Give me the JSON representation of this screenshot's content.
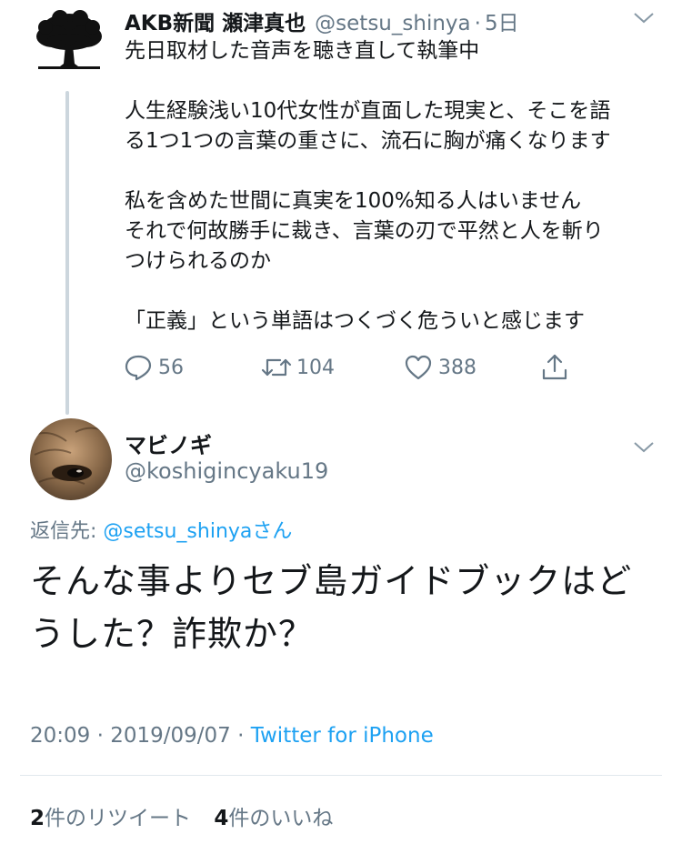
{
  "parent_tweet": {
    "display_name": "AKB新聞 瀬津真也",
    "handle": "@setsu_shinya",
    "separator": "·",
    "time": "5日",
    "paragraphs": [
      "先日取材した音声を聴き直して執筆中",
      "人生経験浅い10代女性が直面した現実と、そこを語\nる1つ1つの言葉の重さに、流石に胸が痛くなります",
      "私を含めた世間に真実を100%知る人はいません\nそれで何故勝手に裁き、言葉の刃で平然と人を斬り\nつけられるのか",
      "「正義」という単語はつくづく危ういと感じます"
    ],
    "reply_count": "56",
    "retweet_count": "104",
    "like_count": "388"
  },
  "reply_tweet": {
    "display_name": "マビノギ",
    "handle": "@koshigincyaku19",
    "replying_label": "返信先: ",
    "replying_mention": "@setsu_shinya",
    "replying_suffix": "さん",
    "text": "そんな事よりセブ島ガイドブックはどうした？詐欺か？",
    "time": "20:09",
    "meta_separator": " · ",
    "date": "2019/09/07",
    "source": "Twitter for iPhone",
    "retweets_count": "2",
    "retweets_label": "件のリツイート",
    "likes_count": "4",
    "likes_label": "件のいいね"
  },
  "colors": {
    "text": "#14171a",
    "secondary": "#657786",
    "link": "#1da1f2",
    "thread_line": "#ccd6dd",
    "divider": "#e1e8ed"
  },
  "icons": {
    "parent_avatar": "tree-logo",
    "reply_avatar": "dog-face-photo",
    "reply": "speech-bubble-icon",
    "retweet": "retweet-arrows-icon",
    "like": "heart-icon",
    "share": "share-upload-icon",
    "more": "chevron-down-icon"
  }
}
